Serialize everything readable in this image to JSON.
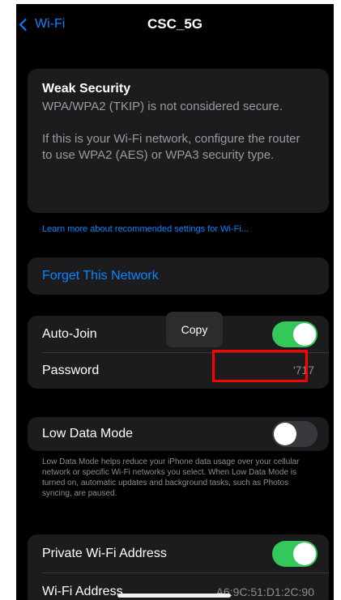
{
  "nav": {
    "back_label": "Wi-Fi",
    "title": "CSC_5G"
  },
  "security": {
    "title": "Weak Security",
    "text1": "WPA/WPA2 (TKIP) is not considered secure.",
    "text2": "If this is your Wi-Fi network, configure the router to use WPA2 (AES) or WPA3 security type."
  },
  "learn_more": "Learn more about recommended settings for Wi-Fi...",
  "forget_label": "Forget This Network",
  "auto_join": {
    "label": "Auto-Join",
    "state": "on"
  },
  "copy_label": "Copy",
  "password": {
    "label": "Password",
    "value": "'717"
  },
  "low_data": {
    "label": "Low Data Mode",
    "state": "off",
    "description": "Low Data Mode helps reduce your iPhone data usage over your cellular network or specific Wi-Fi networks you select. When Low Data Mode is turned on, automatic updates and background tasks, such as Photos syncing, are paused."
  },
  "private_address": {
    "label": "Private Wi-Fi Address",
    "state": "on"
  },
  "wifi_address": {
    "label": "Wi-Fi Address",
    "value": "A6:9C:51:D1:2C:90"
  },
  "colors": {
    "accent": "#0a84ff",
    "toggle_on": "#34c759",
    "highlight": "#ff0000"
  }
}
